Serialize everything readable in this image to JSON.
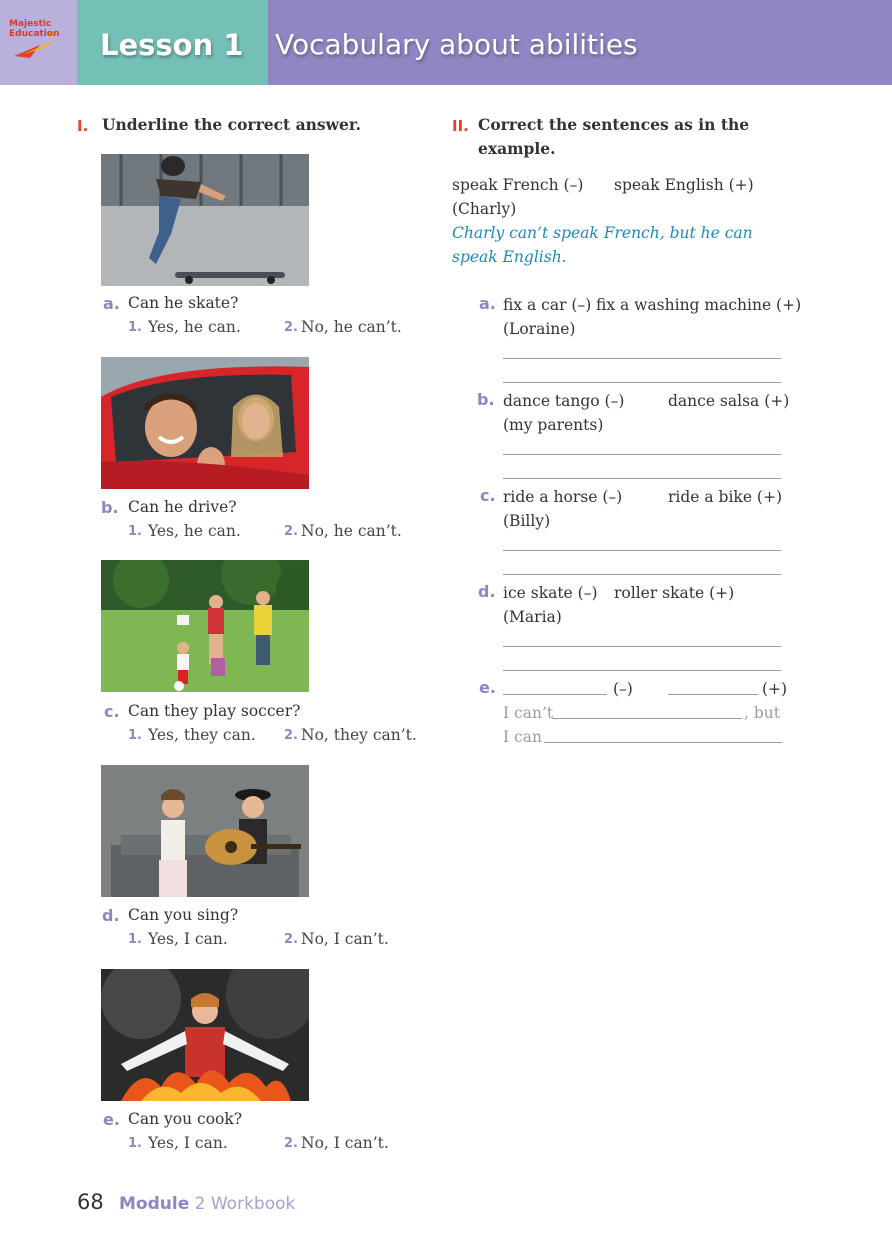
{
  "header": {
    "logo_text_1": "Majestic",
    "logo_text_2": "Education",
    "lesson": "Lesson 1",
    "title": "Vocabulary about abilities"
  },
  "section1": {
    "num": "I.",
    "title": "Underline the correct answer.",
    "questions": [
      {
        "letter": "a.",
        "text": "Can he skate?",
        "opt1_num": "1.",
        "opt1": "Yes, he can.",
        "opt2_num": "2.",
        "opt2": "No, he can’t.",
        "photo": "boy falling off skateboard"
      },
      {
        "letter": "b.",
        "text": "Can he drive?",
        "opt1_num": "1.",
        "opt1": "Yes, he can.",
        "opt2_num": "2.",
        "opt2": "No, he can’t.",
        "photo": "man and woman in red car"
      },
      {
        "letter": "c.",
        "text": "Can they play soccer?",
        "opt1_num": "1.",
        "opt1": "Yes, they can.",
        "opt2_num": "2.",
        "opt2": "No, they can’t.",
        "photo": "family playing soccer in park"
      },
      {
        "letter": "d.",
        "text": "Can you sing?",
        "opt1_num": "1.",
        "opt1": "Yes, I can.",
        "opt2_num": "2.",
        "opt2": "No, I can’t.",
        "photo": "man with guitar and woman covering ears"
      },
      {
        "letter": "e.",
        "text": "Can you cook?",
        "opt1_num": "1.",
        "opt1": "Yes, I can.",
        "opt2_num": "2.",
        "opt2": "No, I can’t.",
        "photo": "woman with burning pan"
      }
    ]
  },
  "section2": {
    "num": "II.",
    "title_line1": "Correct the sentences as in the",
    "title_line2": "example.",
    "example": {
      "neg": "speak French (–)",
      "pos": "speak English (+)",
      "who": "(Charly)",
      "answer_line1": "Charly can’t speak French, but he can",
      "answer_line2": "speak English."
    },
    "items": [
      {
        "letter": "a.",
        "neg": "fix a car (–)",
        "pos": "fix a washing machine (+)",
        "who": "(Loraine)"
      },
      {
        "letter": "b.",
        "neg": "dance tango (–)",
        "pos": "dance salsa (+)",
        "who": "(my parents)"
      },
      {
        "letter": "c.",
        "neg": "ride a horse (–)",
        "pos": "ride a bike (+)",
        "who": "(Billy)"
      },
      {
        "letter": "d.",
        "neg": "ice skate (–)",
        "pos": "roller skate (+)",
        "who": "(Maria)"
      }
    ],
    "item_e": {
      "letter": "e.",
      "neg": "(–)",
      "pos": "(+)",
      "line1_start": "I can’t",
      "line1_end": ", but",
      "line2_start": "I can"
    }
  },
  "footer": {
    "page": "68",
    "module": "Module",
    "workbook": "2 Workbook"
  }
}
